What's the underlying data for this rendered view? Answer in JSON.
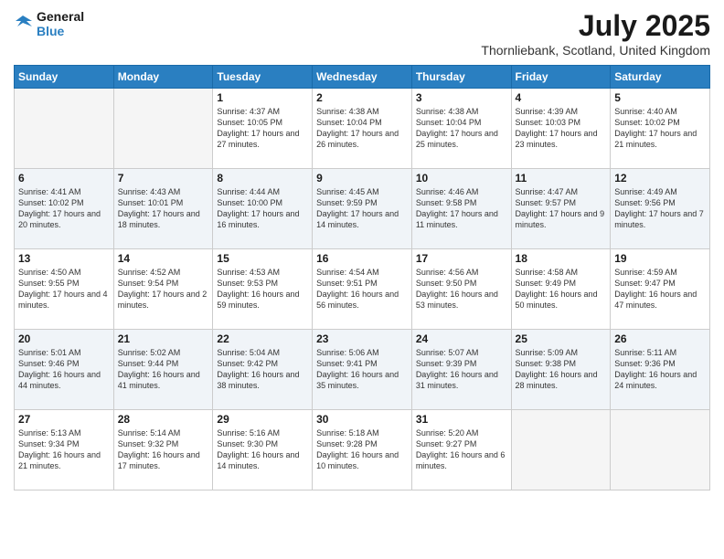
{
  "header": {
    "logo_line1": "General",
    "logo_line2": "Blue",
    "month_year": "July 2025",
    "location": "Thornliebank, Scotland, United Kingdom"
  },
  "days_of_week": [
    "Sunday",
    "Monday",
    "Tuesday",
    "Wednesday",
    "Thursday",
    "Friday",
    "Saturday"
  ],
  "weeks": [
    [
      {
        "day": null,
        "sunrise": null,
        "sunset": null,
        "daylight": null
      },
      {
        "day": null,
        "sunrise": null,
        "sunset": null,
        "daylight": null
      },
      {
        "day": "1",
        "sunrise": "4:37 AM",
        "sunset": "10:05 PM",
        "daylight": "17 hours and 27 minutes."
      },
      {
        "day": "2",
        "sunrise": "4:38 AM",
        "sunset": "10:04 PM",
        "daylight": "17 hours and 26 minutes."
      },
      {
        "day": "3",
        "sunrise": "4:38 AM",
        "sunset": "10:04 PM",
        "daylight": "17 hours and 25 minutes."
      },
      {
        "day": "4",
        "sunrise": "4:39 AM",
        "sunset": "10:03 PM",
        "daylight": "17 hours and 23 minutes."
      },
      {
        "day": "5",
        "sunrise": "4:40 AM",
        "sunset": "10:02 PM",
        "daylight": "17 hours and 21 minutes."
      }
    ],
    [
      {
        "day": "6",
        "sunrise": "4:41 AM",
        "sunset": "10:02 PM",
        "daylight": "17 hours and 20 minutes."
      },
      {
        "day": "7",
        "sunrise": "4:43 AM",
        "sunset": "10:01 PM",
        "daylight": "17 hours and 18 minutes."
      },
      {
        "day": "8",
        "sunrise": "4:44 AM",
        "sunset": "10:00 PM",
        "daylight": "17 hours and 16 minutes."
      },
      {
        "day": "9",
        "sunrise": "4:45 AM",
        "sunset": "9:59 PM",
        "daylight": "17 hours and 14 minutes."
      },
      {
        "day": "10",
        "sunrise": "4:46 AM",
        "sunset": "9:58 PM",
        "daylight": "17 hours and 11 minutes."
      },
      {
        "day": "11",
        "sunrise": "4:47 AM",
        "sunset": "9:57 PM",
        "daylight": "17 hours and 9 minutes."
      },
      {
        "day": "12",
        "sunrise": "4:49 AM",
        "sunset": "9:56 PM",
        "daylight": "17 hours and 7 minutes."
      }
    ],
    [
      {
        "day": "13",
        "sunrise": "4:50 AM",
        "sunset": "9:55 PM",
        "daylight": "17 hours and 4 minutes."
      },
      {
        "day": "14",
        "sunrise": "4:52 AM",
        "sunset": "9:54 PM",
        "daylight": "17 hours and 2 minutes."
      },
      {
        "day": "15",
        "sunrise": "4:53 AM",
        "sunset": "9:53 PM",
        "daylight": "16 hours and 59 minutes."
      },
      {
        "day": "16",
        "sunrise": "4:54 AM",
        "sunset": "9:51 PM",
        "daylight": "16 hours and 56 minutes."
      },
      {
        "day": "17",
        "sunrise": "4:56 AM",
        "sunset": "9:50 PM",
        "daylight": "16 hours and 53 minutes."
      },
      {
        "day": "18",
        "sunrise": "4:58 AM",
        "sunset": "9:49 PM",
        "daylight": "16 hours and 50 minutes."
      },
      {
        "day": "19",
        "sunrise": "4:59 AM",
        "sunset": "9:47 PM",
        "daylight": "16 hours and 47 minutes."
      }
    ],
    [
      {
        "day": "20",
        "sunrise": "5:01 AM",
        "sunset": "9:46 PM",
        "daylight": "16 hours and 44 minutes."
      },
      {
        "day": "21",
        "sunrise": "5:02 AM",
        "sunset": "9:44 PM",
        "daylight": "16 hours and 41 minutes."
      },
      {
        "day": "22",
        "sunrise": "5:04 AM",
        "sunset": "9:42 PM",
        "daylight": "16 hours and 38 minutes."
      },
      {
        "day": "23",
        "sunrise": "5:06 AM",
        "sunset": "9:41 PM",
        "daylight": "16 hours and 35 minutes."
      },
      {
        "day": "24",
        "sunrise": "5:07 AM",
        "sunset": "9:39 PM",
        "daylight": "16 hours and 31 minutes."
      },
      {
        "day": "25",
        "sunrise": "5:09 AM",
        "sunset": "9:38 PM",
        "daylight": "16 hours and 28 minutes."
      },
      {
        "day": "26",
        "sunrise": "5:11 AM",
        "sunset": "9:36 PM",
        "daylight": "16 hours and 24 minutes."
      }
    ],
    [
      {
        "day": "27",
        "sunrise": "5:13 AM",
        "sunset": "9:34 PM",
        "daylight": "16 hours and 21 minutes."
      },
      {
        "day": "28",
        "sunrise": "5:14 AM",
        "sunset": "9:32 PM",
        "daylight": "16 hours and 17 minutes."
      },
      {
        "day": "29",
        "sunrise": "5:16 AM",
        "sunset": "9:30 PM",
        "daylight": "16 hours and 14 minutes."
      },
      {
        "day": "30",
        "sunrise": "5:18 AM",
        "sunset": "9:28 PM",
        "daylight": "16 hours and 10 minutes."
      },
      {
        "day": "31",
        "sunrise": "5:20 AM",
        "sunset": "9:27 PM",
        "daylight": "16 hours and 6 minutes."
      },
      {
        "day": null,
        "sunrise": null,
        "sunset": null,
        "daylight": null
      },
      {
        "day": null,
        "sunrise": null,
        "sunset": null,
        "daylight": null
      }
    ]
  ],
  "labels": {
    "sunrise": "Sunrise:",
    "sunset": "Sunset:",
    "daylight": "Daylight:"
  }
}
